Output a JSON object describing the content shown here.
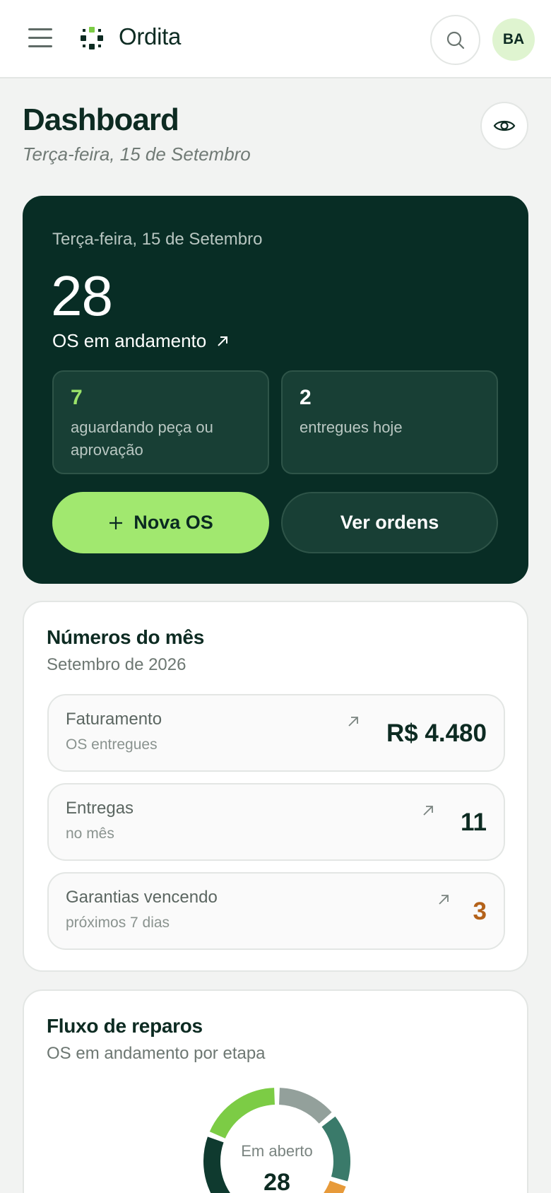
{
  "header": {
    "brand": "Ordita",
    "avatar_initials": "BA",
    "icons": [
      "menu-icon",
      "search-icon"
    ]
  },
  "page": {
    "title": "Dashboard",
    "date": "Terça-feira, 15 de Setembro"
  },
  "hero": {
    "date": "Terça-feira, 15 de Setembro",
    "count": "28",
    "label": "OS em andamento",
    "waiting": {
      "value": "7",
      "label": "aguardando peça ou aprovação"
    },
    "delivered": {
      "value": "2",
      "label": "entregues hoje"
    },
    "new_button": "Nova OS",
    "orders_button": "Ver ordens"
  },
  "month": {
    "title": "Números do mês",
    "subtitle": "Setembro de 2026",
    "stats": [
      {
        "label": "Faturamento",
        "sub": "OS entregues",
        "value": "R$ 4.480",
        "color": "#0d2b22"
      },
      {
        "label": "Entregas",
        "sub": "no mês",
        "value": "11",
        "color": "#0d2b22"
      },
      {
        "label": "Garantias vencendo",
        "sub": "próximos 7 dias",
        "value": "3",
        "color": "#b4621a"
      }
    ]
  },
  "flow": {
    "title": "Fluxo de reparos",
    "subtitle": "OS em andamento por etapa",
    "center_label": "Em aberto",
    "center_value": "28",
    "segments": [
      {
        "fraction": 0.14,
        "color": "#93a09b"
      },
      {
        "fraction": 0.16,
        "color": "#3a7a6a"
      },
      {
        "fraction": 0.06,
        "color": "#e79a3a"
      },
      {
        "fraction": 0.45,
        "color": "#0f3a2f"
      },
      {
        "fraction": 0.19,
        "color": "#7ccc45"
      }
    ]
  },
  "colors": {
    "hero_bg": "#082d25",
    "accent": "#a1e86f",
    "waiting_accent": "#9be36a",
    "warning": "#b4621a"
  }
}
